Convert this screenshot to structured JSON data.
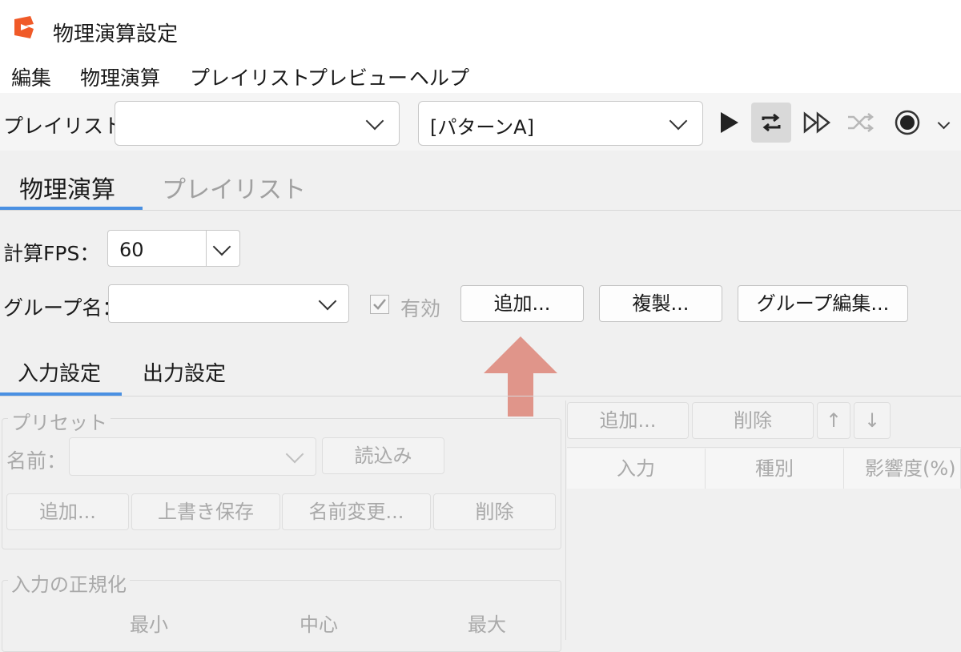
{
  "window": {
    "title": "物理演算設定"
  },
  "menu": {
    "items": [
      "編集",
      "物理演算",
      "プレイリスト",
      "プレビュー",
      "ヘルプ"
    ]
  },
  "toolbar": {
    "playlist_label": "プレイリスト：",
    "playlist_value": "",
    "pattern_value": "[パターンA]",
    "icons": [
      "play-icon",
      "repeat-icon",
      "next-icon",
      "shuffle-icon",
      "record-icon",
      "chevron-down-icon"
    ]
  },
  "main_tabs": {
    "tabs": [
      "物理演算",
      "プレイリスト"
    ],
    "active": 0
  },
  "physics": {
    "fps_label": "計算FPS：",
    "fps_value": "60",
    "group_label": "グループ名：",
    "group_value": "",
    "enabled_label": "有効",
    "enabled_checked": true,
    "add_button": "追加...",
    "duplicate_button": "複製...",
    "group_edit_button": "グループ編集..."
  },
  "sub_tabs": {
    "tabs": [
      "入力設定",
      "出力設定"
    ],
    "active": 0
  },
  "preset": {
    "legend": "プリセット",
    "name_label": "名前：",
    "name_value": "",
    "load_button": "読込み",
    "add_button": "追加...",
    "overwrite_button": "上書き保存",
    "rename_button": "名前変更...",
    "delete_button": "削除"
  },
  "normalize": {
    "legend": "入力の正規化",
    "columns": [
      "最小",
      "中心",
      "最大"
    ]
  },
  "input_list": {
    "add_button": "追加...",
    "delete_button": "削除",
    "up_button": "↑",
    "down_button": "↓",
    "columns": [
      "入力",
      "種別",
      "影響度(%)"
    ]
  },
  "colors": {
    "accent": "#4a90e2",
    "arrow": "#e0958a",
    "app_icon": "#f05a28"
  }
}
